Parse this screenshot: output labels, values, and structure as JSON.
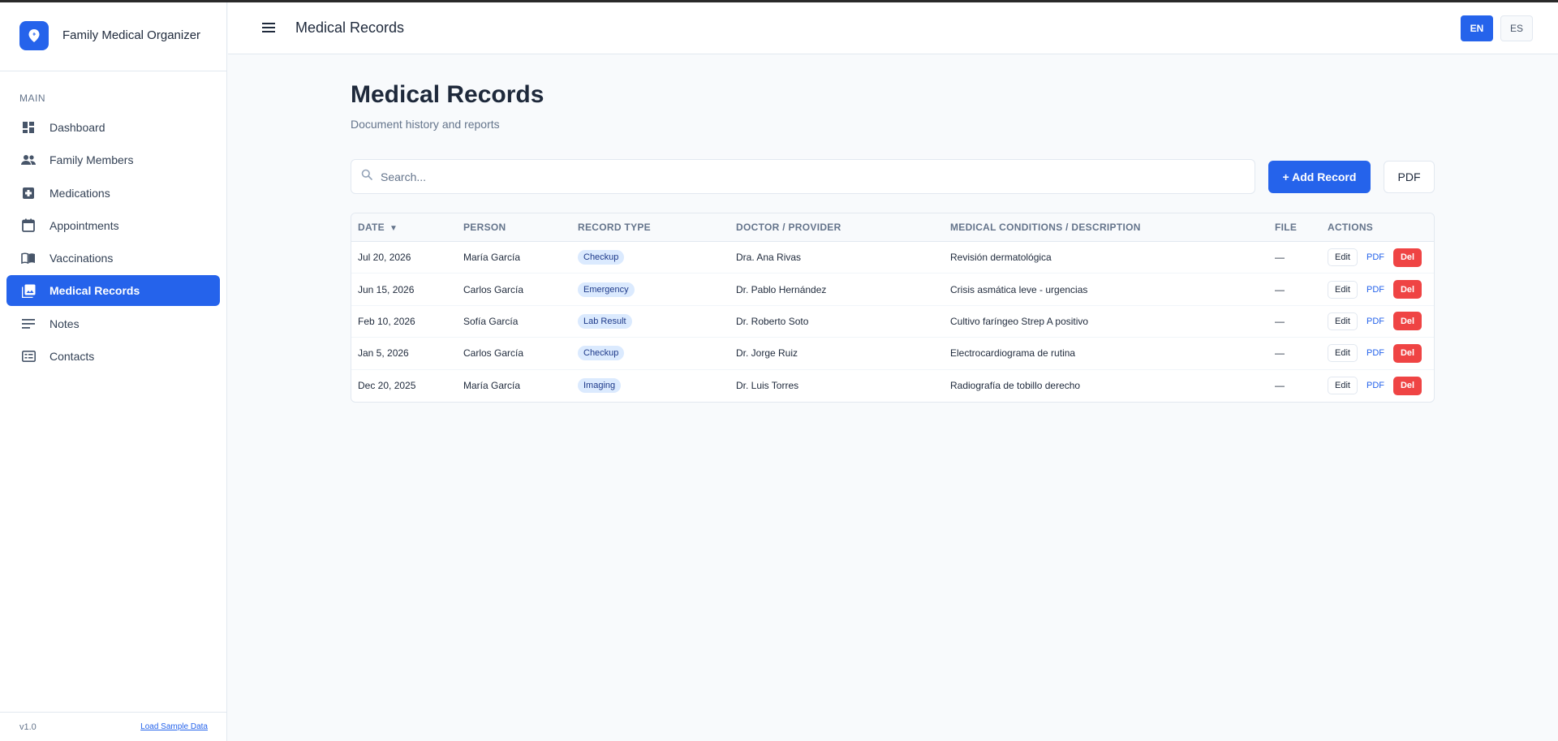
{
  "app": {
    "name": "Family Medical Organizer"
  },
  "sidebar": {
    "section_label": "MAIN",
    "items": [
      {
        "label": "Dashboard",
        "icon": "dashboard-icon",
        "active": false
      },
      {
        "label": "Family Members",
        "icon": "people-icon",
        "active": false
      },
      {
        "label": "Medications",
        "icon": "medical-cross-icon",
        "active": false
      },
      {
        "label": "Appointments",
        "icon": "calendar-icon",
        "active": false
      },
      {
        "label": "Vaccinations",
        "icon": "book-icon",
        "active": false
      },
      {
        "label": "Medical Records",
        "icon": "photo-library-icon",
        "active": true
      },
      {
        "label": "Notes",
        "icon": "notes-lines-icon",
        "active": false
      },
      {
        "label": "Contacts",
        "icon": "contact-card-icon",
        "active": false
      }
    ],
    "version": "v1.0",
    "load_sample": "Load Sample Data"
  },
  "header": {
    "title": "Medical Records",
    "lang_en": "EN",
    "lang_es": "ES"
  },
  "main": {
    "title": "Medical Records",
    "subtitle": "Document history and reports",
    "search_placeholder": "Search...",
    "add_button": "+ Add Record",
    "pdf_button": "PDF"
  },
  "table": {
    "columns": [
      "DATE",
      "PERSON",
      "RECORD TYPE",
      "DOCTOR / PROVIDER",
      "MEDICAL CONDITIONS / DESCRIPTION",
      "FILE",
      "ACTIONS"
    ],
    "sort_indicator": "▼",
    "rows": [
      {
        "date": "Jul 20, 2026",
        "person": "María García",
        "type": "Checkup",
        "doctor": "Dra. Ana Rivas",
        "description": "Revisión dermatológica",
        "file": "—"
      },
      {
        "date": "Jun 15, 2026",
        "person": "Carlos García",
        "type": "Emergency",
        "doctor": "Dr. Pablo Hernández",
        "description": "Crisis asmática leve - urgencias",
        "file": "—"
      },
      {
        "date": "Feb 10, 2026",
        "person": "Sofía García",
        "type": "Lab Result",
        "doctor": "Dr. Roberto Soto",
        "description": "Cultivo faríngeo Strep A positivo",
        "file": "—"
      },
      {
        "date": "Jan 5, 2026",
        "person": "Carlos García",
        "type": "Checkup",
        "doctor": "Dr. Jorge Ruiz",
        "description": "Electrocardiograma de rutina",
        "file": "—"
      },
      {
        "date": "Dec 20, 2025",
        "person": "María García",
        "type": "Imaging",
        "doctor": "Dr. Luis Torres",
        "description": "Radiografía de tobillo derecho",
        "file": "—"
      }
    ],
    "actions": {
      "edit": "Edit",
      "pdf": "PDF",
      "del": "Del"
    }
  },
  "colors": {
    "accent": "#2563eb",
    "danger": "#ef4444",
    "badge_bg": "#dbeafe"
  }
}
